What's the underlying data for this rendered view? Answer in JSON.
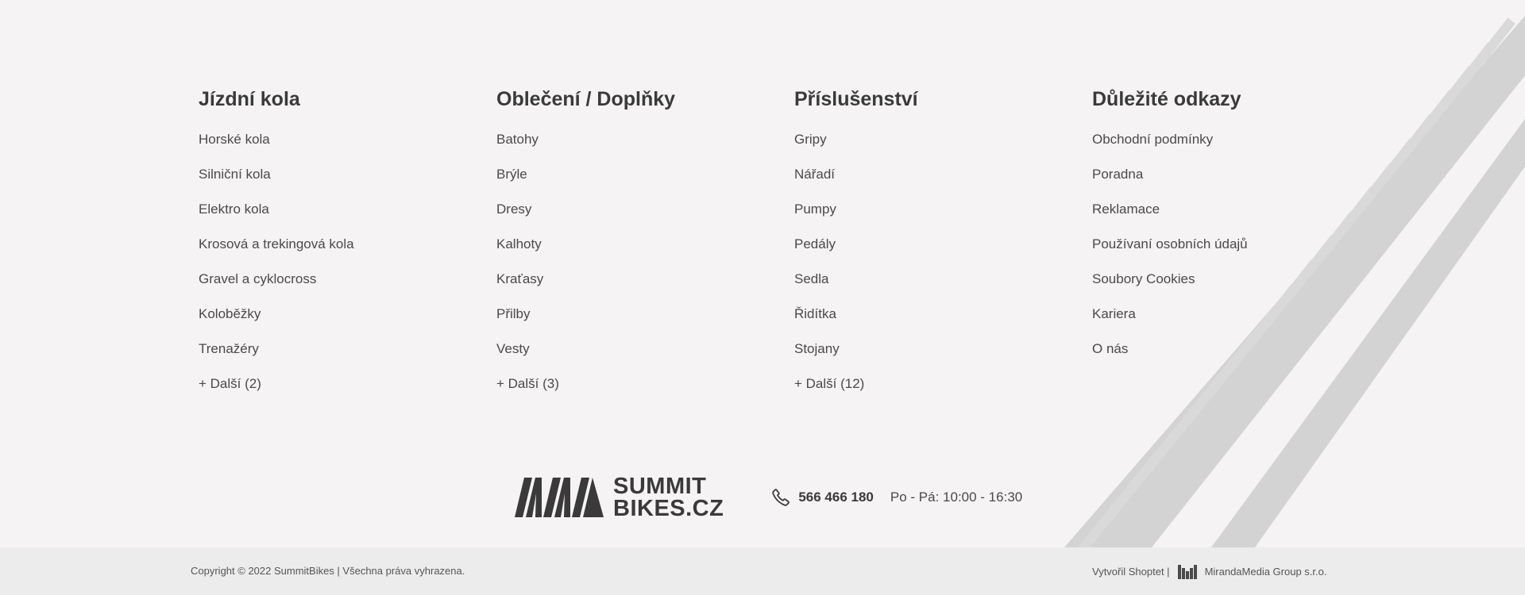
{
  "columns": [
    {
      "title": "Jízdní kola",
      "links": [
        "Horské kola",
        "Silniční kola",
        "Elektro kola",
        "Krosová a trekingová kola",
        "Gravel a cyklocross",
        "Koloběžky",
        "Trenažéry",
        "+ Další (2)"
      ]
    },
    {
      "title": "Oblečení / Doplňky",
      "links": [
        "Batohy",
        "Brýle",
        "Dresy",
        "Kalhoty",
        "Kraťasy",
        "Přilby",
        "Vesty",
        "+ Další (3)"
      ]
    },
    {
      "title": "Příslušenství",
      "links": [
        "Gripy",
        "Nářadí",
        "Pumpy",
        "Pedály",
        "Sedla",
        "Řidítka",
        "Stojany",
        "+ Další (12)"
      ]
    },
    {
      "title": "Důležité odkazy",
      "links": [
        "Obchodní podmínky",
        "Poradna",
        "Reklamace",
        "Používaní osobních údajů",
        "Soubory Cookies",
        "Kariera",
        "O nás"
      ]
    }
  ],
  "brand": {
    "line1": "SUMMIT",
    "line2": "BIKES.CZ"
  },
  "contact": {
    "phone": "566 466 180",
    "hours": "Po - Pá: 10:00 - 16:30"
  },
  "bottom": {
    "copyright": "Copyright  © 2022 SummitBikes | Všechna práva vyhrazena.",
    "credit_prefix": "Vytvořil Shoptet |",
    "credit_company": "MirandaMedia Group s.r.o."
  },
  "colors": {
    "background": "#f5f3f4",
    "bottom_bar": "#ececec",
    "text": "#3a3a3a",
    "track": "#d6d6d6"
  },
  "icons": [
    "phone-icon",
    "mirandamedia-logo-icon",
    "summit-logo-mark"
  ]
}
